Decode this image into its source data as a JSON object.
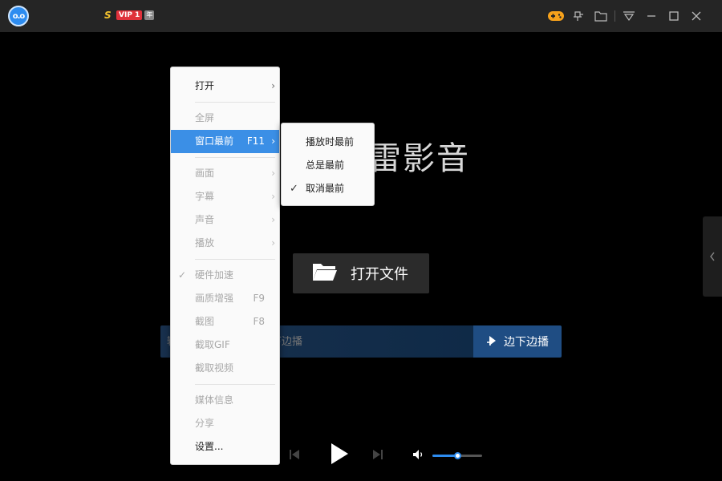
{
  "titlebar": {
    "badge_s": "S",
    "badge_vip": "VIP 1",
    "badge_new": "年",
    "icons": [
      "game-icon",
      "pin-icon",
      "folder-icon",
      "skin-icon",
      "minimize-icon",
      "maximize-icon",
      "close-icon"
    ]
  },
  "main": {
    "brand": "雷影音",
    "open_file_label": "打开文件",
    "url_placeholder": "输入视频地址，立即边下边播",
    "url_button_label": "边下边播"
  },
  "menu": {
    "items": [
      {
        "label": "打开",
        "shortcut": "",
        "submenu": true,
        "disabled": false
      },
      {
        "label": "全屏",
        "shortcut": "",
        "submenu": false,
        "disabled": true
      },
      {
        "label": "窗口最前",
        "shortcut": "F11",
        "submenu": true,
        "disabled": false
      },
      {
        "label": "画面",
        "shortcut": "",
        "submenu": true,
        "disabled": true
      },
      {
        "label": "字幕",
        "shortcut": "",
        "submenu": true,
        "disabled": true
      },
      {
        "label": "声音",
        "shortcut": "",
        "submenu": true,
        "disabled": true
      },
      {
        "label": "播放",
        "shortcut": "",
        "submenu": true,
        "disabled": true
      },
      {
        "label": "硬件加速",
        "shortcut": "",
        "submenu": false,
        "disabled": true,
        "checked": true
      },
      {
        "label": "画质增强",
        "shortcut": "F9",
        "submenu": false,
        "disabled": true
      },
      {
        "label": "截图",
        "shortcut": "F8",
        "submenu": false,
        "disabled": true
      },
      {
        "label": "截取GIF",
        "shortcut": "",
        "submenu": false,
        "disabled": true
      },
      {
        "label": "截取视频",
        "shortcut": "",
        "submenu": false,
        "disabled": true
      },
      {
        "label": "媒体信息",
        "shortcut": "",
        "submenu": false,
        "disabled": true
      },
      {
        "label": "分享",
        "shortcut": "",
        "submenu": false,
        "disabled": true
      },
      {
        "label": "设置...",
        "shortcut": "",
        "submenu": false,
        "disabled": false
      }
    ],
    "arrow": "›",
    "check": "✓"
  },
  "submenu": {
    "items": [
      {
        "label": "播放时最前",
        "checked": false
      },
      {
        "label": "总是最前",
        "checked": false
      },
      {
        "label": "取消最前",
        "checked": true
      }
    ]
  },
  "controls": {
    "volume_level": 0.5
  },
  "colors": {
    "accent": "#3b8fe6",
    "titlebar": "#252525",
    "vip": "#e0313b",
    "game": "#f7a21b"
  }
}
